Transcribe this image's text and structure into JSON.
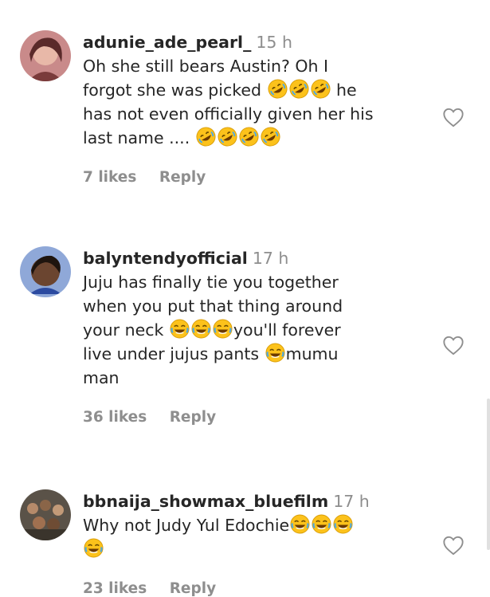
{
  "comments": [
    {
      "username": "adunie_ade_pearl_",
      "time": "15 h",
      "lines": [
        [
          "Oh she still bears Austin? Oh I"
        ],
        [
          "forgot she was picked ",
          "E:rofl",
          "E:rofl",
          "E:rofl",
          " he"
        ],
        [
          "has not even officially given her his"
        ],
        [
          "last name .... ",
          "E:rofl",
          "E:rofl",
          "E:rofl",
          "E:rofl"
        ]
      ],
      "likes": "7 likes",
      "reply": "Reply"
    },
    {
      "username": "balyntendyofficial",
      "time": "17 h",
      "lines": [
        [
          "Juju has finally tie you together"
        ],
        [
          "when you put that thing around"
        ],
        [
          "your neck ",
          "E:joy",
          "E:joy",
          "E:joy",
          "you'll forever"
        ],
        [
          "live under jujus pants ",
          "E:joy",
          "mumu"
        ],
        [
          "man"
        ]
      ],
      "likes": "36 likes",
      "reply": "Reply"
    },
    {
      "username": "bbnaija_showmax_bluefilm",
      "time": "17 h",
      "lines": [
        [
          "Why not Judy Yul Edochie",
          "E:joy",
          "E:joy",
          "E:joy"
        ],
        [
          "E:joy"
        ]
      ],
      "likes": "23 likes",
      "reply": "Reply"
    }
  ],
  "icons": {
    "like": "heart-outline-icon",
    "emoji_rofl": "rolling-on-floor-laughing-emoji",
    "emoji_joy": "face-with-tears-of-joy-emoji"
  }
}
